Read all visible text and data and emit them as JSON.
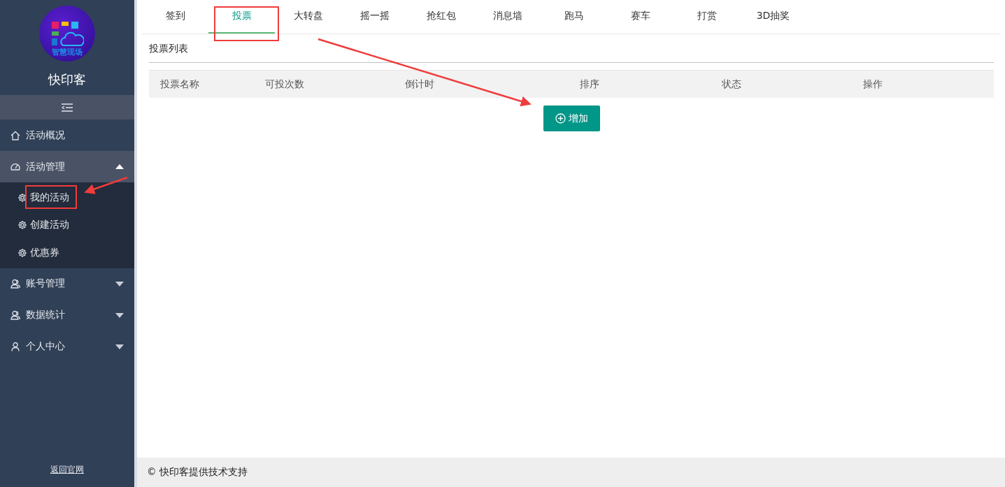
{
  "sidebar": {
    "logo": {
      "text": "智慧现场"
    },
    "title": "快印客",
    "menu": [
      {
        "label": "活动概况",
        "selected": false
      },
      {
        "label": "活动管理",
        "expanded": true,
        "selected": true,
        "children": [
          {
            "label": "我的活动"
          },
          {
            "label": "创建活动"
          },
          {
            "label": "优惠券"
          }
        ]
      },
      {
        "label": "账号管理",
        "expanded": false,
        "selected": false
      },
      {
        "label": "数据统计",
        "expanded": false,
        "selected": false
      },
      {
        "label": "个人中心",
        "expanded": false,
        "selected": false
      }
    ],
    "footer_link": "返回官网"
  },
  "tabs": [
    {
      "label": "签到",
      "selected": false
    },
    {
      "label": "投票",
      "selected": true
    },
    {
      "label": "大转盘",
      "selected": false
    },
    {
      "label": "摇一摇",
      "selected": false
    },
    {
      "label": "抢红包",
      "selected": false
    },
    {
      "label": "消息墙",
      "selected": false
    },
    {
      "label": "跑马",
      "selected": false
    },
    {
      "label": "赛车",
      "selected": false
    },
    {
      "label": "打赏",
      "selected": false
    },
    {
      "label": "3D抽奖",
      "selected": false
    }
  ],
  "section_title": "投票列表",
  "table": {
    "columns": [
      "投票名称",
      "可投次数",
      "倒计时",
      "排序",
      "状态",
      "操作"
    ]
  },
  "add_button": "增加",
  "footer": "© 快印客提供技术支持"
}
